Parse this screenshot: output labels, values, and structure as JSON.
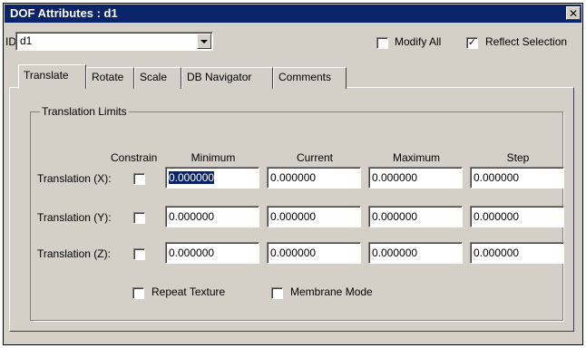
{
  "window": {
    "title": "DOF Attributes : d1",
    "close_glyph": "✕"
  },
  "id_field": {
    "label": "ID:",
    "value": "d1"
  },
  "options": [
    {
      "label": "Modify All",
      "checked": false
    },
    {
      "label": "Reflect Selection",
      "checked": true
    }
  ],
  "tabs": [
    "Translate",
    "Rotate",
    "Scale",
    "DB Navigator",
    "Comments"
  ],
  "active_tab": "Translate",
  "group": {
    "label": "Translation Limits",
    "columns": {
      "constrain": "Constrain",
      "minimum": "Minimum",
      "current": "Current",
      "maximum": "Maximum",
      "step": "Step"
    },
    "rows": [
      {
        "label": "Translation (X):",
        "constrain": false,
        "minimum": "0.000000",
        "current": "0.000000",
        "maximum": "0.000000",
        "step": "0.000000"
      },
      {
        "label": "Translation (Y):",
        "constrain": false,
        "minimum": "0.000000",
        "current": "0.000000",
        "maximum": "0.000000",
        "step": "0.000000"
      },
      {
        "label": "Translation (Z):",
        "constrain": false,
        "minimum": "0.000000",
        "current": "0.000000",
        "maximum": "0.000000",
        "step": "0.000000"
      }
    ]
  },
  "bottom_options": [
    {
      "label": "Repeat Texture",
      "checked": false
    },
    {
      "label": "Membrane Mode",
      "checked": false
    }
  ],
  "colors": {
    "titlebar": "#0a246a",
    "face": "#d4d0c8",
    "selection": "#0a246a"
  }
}
